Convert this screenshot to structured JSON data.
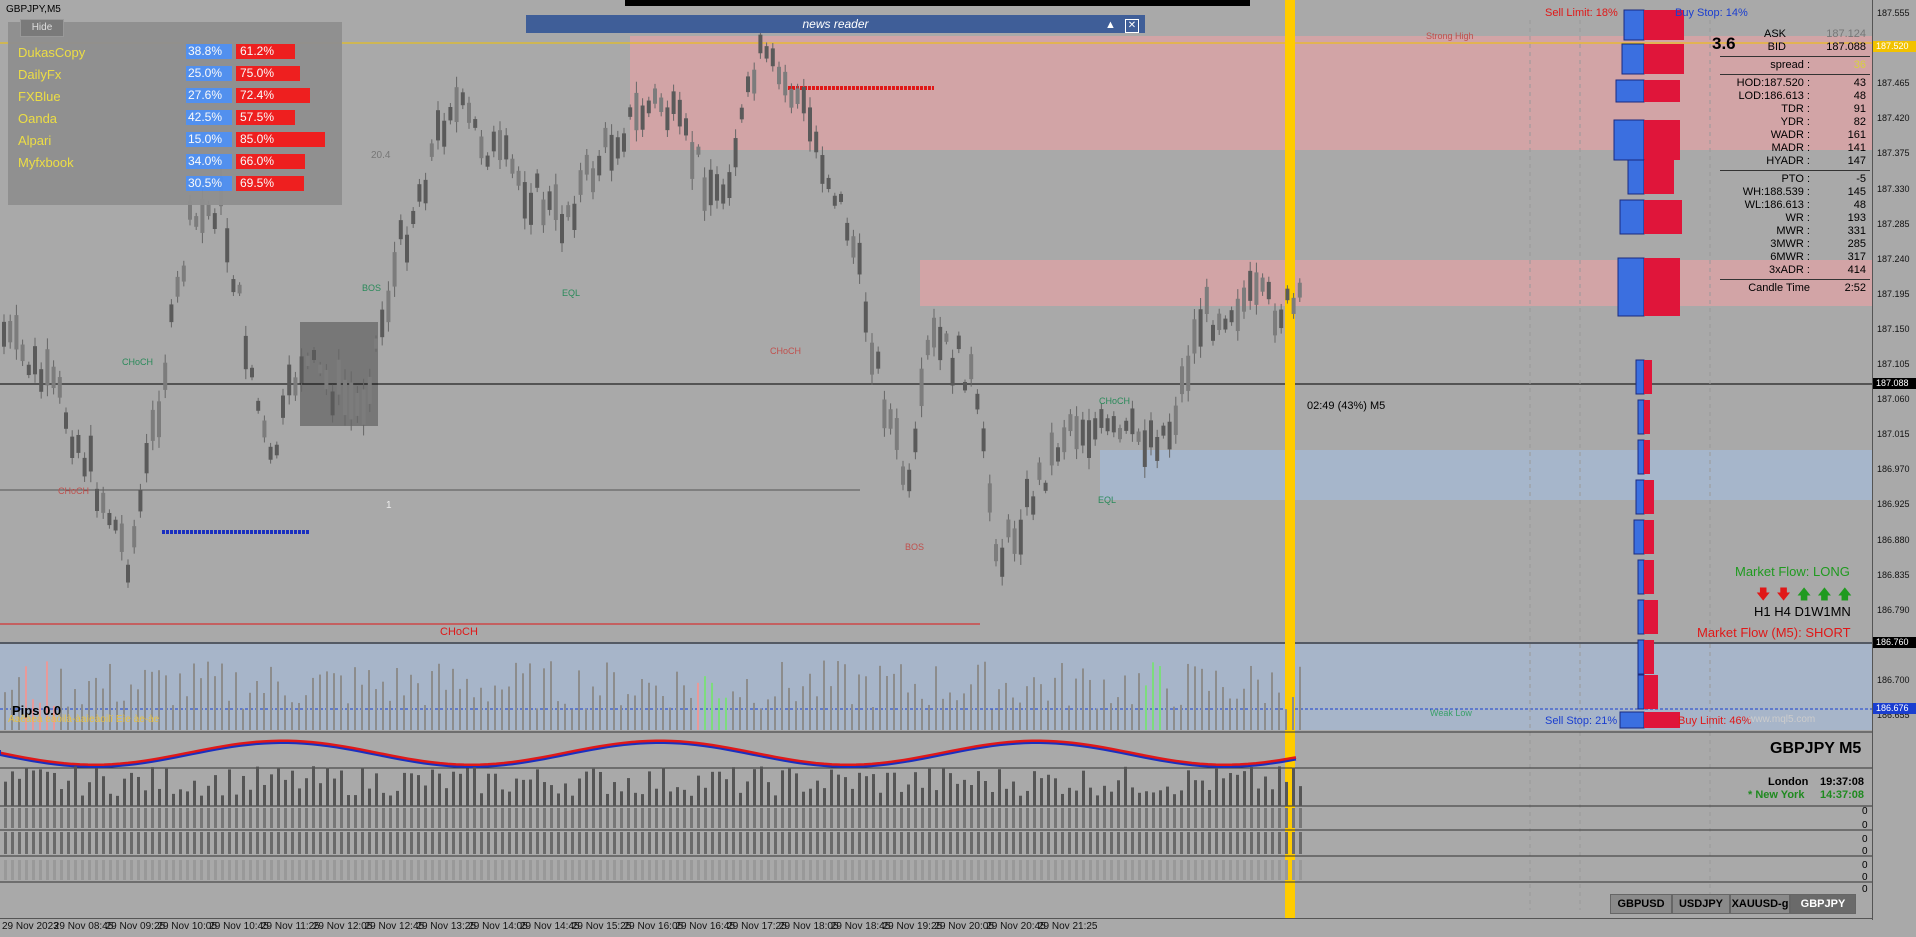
{
  "window": {
    "title": "GBPJPY,M5"
  },
  "sentiment": {
    "hide_label": "Hide",
    "colors": {
      "name": "#f0e040",
      "buy": "#4e8ff2",
      "sell": "#f21818"
    },
    "rows": [
      {
        "name": "DukasCopy",
        "buy": "38.8%",
        "sell": "61.2%"
      },
      {
        "name": "DailyFx",
        "buy": "25.0%",
        "sell": "75.0%"
      },
      {
        "name": "FXBlue",
        "buy": "27.6%",
        "sell": "72.4%"
      },
      {
        "name": "Oanda",
        "buy": "42.5%",
        "sell": "57.5%"
      },
      {
        "name": "Alpari",
        "buy": "15.0%",
        "sell": "85.0%"
      },
      {
        "name": "Myfxbook",
        "buy": "34.0%",
        "sell": "66.0%"
      },
      {
        "name": "",
        "buy": "30.5%",
        "sell": "69.5%"
      }
    ]
  },
  "news_reader": {
    "title": "news reader",
    "collapse_glyph": "▲",
    "close_glyph": "✕"
  },
  "chart": {
    "labels": {
      "strong_high": "Strong High",
      "weak_low": "Weak Low",
      "choch": "CHoCH",
      "bos": "BOS",
      "eql": "EQL",
      "sell_limit": "Sell Limit: 18%",
      "buy_stop": "Buy Stop: 14%",
      "sell_stop": "Sell Stop: 21%",
      "buy_limit": "Buy Limit: 46%",
      "candle_info": "02:49 (43%) M5",
      "level_20_4": "20.4",
      "marker_1": "1",
      "pips": "Pips 0.0",
      "garbled": "Aaêàeà eàòilà-àaìeàoilï Eìe àe-àe",
      "watermark": "www.mql5.com"
    },
    "colors": {
      "up": "#00ff00",
      "down": "#ff0000",
      "buy_bar": "#3b6fe0",
      "sell_bar": "#e0153a",
      "vline": "#ffcc00",
      "supply": "#d9a3a6",
      "demand": "#a6b8d1"
    }
  },
  "price_axis": {
    "ticks": [
      "187.555",
      "187.510",
      "187.465",
      "187.420",
      "187.375",
      "187.330",
      "187.285",
      "187.240",
      "187.195",
      "187.150",
      "187.105",
      "187.060",
      "187.015",
      "186.970",
      "186.925",
      "186.880",
      "186.835",
      "186.790",
      "186.745",
      "186.700",
      "186.655"
    ],
    "tags": {
      "top": "187.520",
      "current": "187.088",
      "low1": "186.760",
      "low2": "186.676"
    }
  },
  "time_axis": {
    "labels": [
      "29 Nov 2023",
      "29 Nov 08:45",
      "29 Nov 09:25",
      "29 Nov 10:05",
      "29 Nov 10:45",
      "29 Nov 11:25",
      "29 Nov 12:05",
      "29 Nov 12:45",
      "29 Nov 13:25",
      "29 Nov 14:05",
      "29 Nov 14:45",
      "29 Nov 15:25",
      "29 Nov 16:05",
      "29 Nov 16:45",
      "29 Nov 17:25",
      "29 Nov 18:05",
      "29 Nov 18:45",
      "29 Nov 19:25",
      "29 Nov 20:05",
      "29 Nov 20:45",
      "29 Nov 21:25"
    ]
  },
  "info_panel": {
    "spread_big": "3.6",
    "ask_label": "ASK",
    "ask": "187.124",
    "bid_label": "BID",
    "bid": "187.088",
    "spread_label": "spread :",
    "spread": "36",
    "rows1": [
      {
        "l": "HOD:187.520 :",
        "r": "43"
      },
      {
        "l": "LOD:186.613 :",
        "r": "48"
      },
      {
        "l": "TDR :",
        "r": "91"
      },
      {
        "l": "YDR :",
        "r": "82"
      },
      {
        "l": "WADR :",
        "r": "161"
      },
      {
        "l": "MADR :",
        "r": "141"
      },
      {
        "l": "HYADR :",
        "r": "147"
      }
    ],
    "rows2": [
      {
        "l": "PTO :",
        "r": "-5"
      },
      {
        "l": "WH:188.539 :",
        "r": "145"
      },
      {
        "l": "WL:186.613 :",
        "r": "48"
      },
      {
        "l": "WR :",
        "r": "193"
      },
      {
        "l": "MWR :",
        "r": "331"
      },
      {
        "l": "3MWR :",
        "r": "285"
      },
      {
        "l": "6MWR :",
        "r": "317"
      },
      {
        "l": "3xADR :",
        "r": "414"
      }
    ],
    "candle_time_label": "Candle Time",
    "candle_time": "2:52"
  },
  "market_flow": {
    "long": "Market Flow: LONG",
    "short": "Market Flow (M5): SHORT",
    "timeframes": "H1 H4 D1W1MN",
    "arrows": [
      "down",
      "down",
      "up",
      "up",
      "up"
    ]
  },
  "bottom_panel": {
    "symbol": "GBPJPY  M5",
    "london_label": "London",
    "london_time": "19:37:08",
    "ny_label": "* New York",
    "ny_time": "14:37:08",
    "zero": "0"
  },
  "symbols": [
    {
      "label": "GBPUSD",
      "active": false
    },
    {
      "label": "USDJPY",
      "active": false
    },
    {
      "label": "XAUUSD-g",
      "active": false
    },
    {
      "label": "GBPJPY",
      "active": true
    }
  ]
}
